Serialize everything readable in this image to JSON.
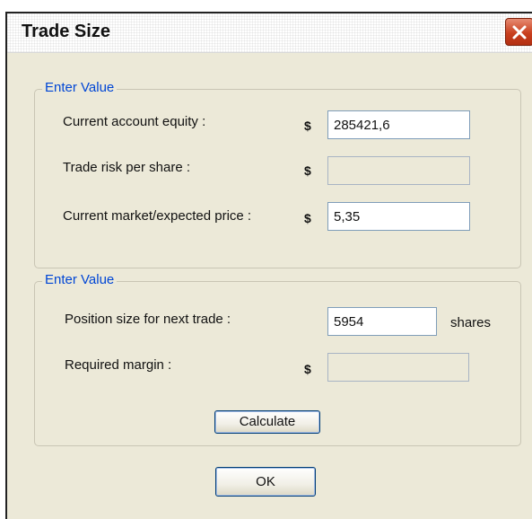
{
  "window": {
    "title": "Trade Size"
  },
  "group1": {
    "legend": "Enter Value",
    "rows": [
      {
        "label": "Current account equity :",
        "currency": "$",
        "value": "285421,6"
      },
      {
        "label": "Trade risk per share :",
        "currency": "$",
        "value": ""
      },
      {
        "label": "Current market/expected price :",
        "currency": "$",
        "value": "5,35"
      }
    ]
  },
  "group2": {
    "legend": "Enter Value",
    "position_size": {
      "label": "Position size for next trade :",
      "value": "5954",
      "unit": "shares"
    },
    "margin": {
      "label": "Required margin :",
      "currency": "$",
      "value": ""
    },
    "calculate_label": "Calculate"
  },
  "ok_label": "OK",
  "icons": {
    "close": "close-x-icon"
  }
}
